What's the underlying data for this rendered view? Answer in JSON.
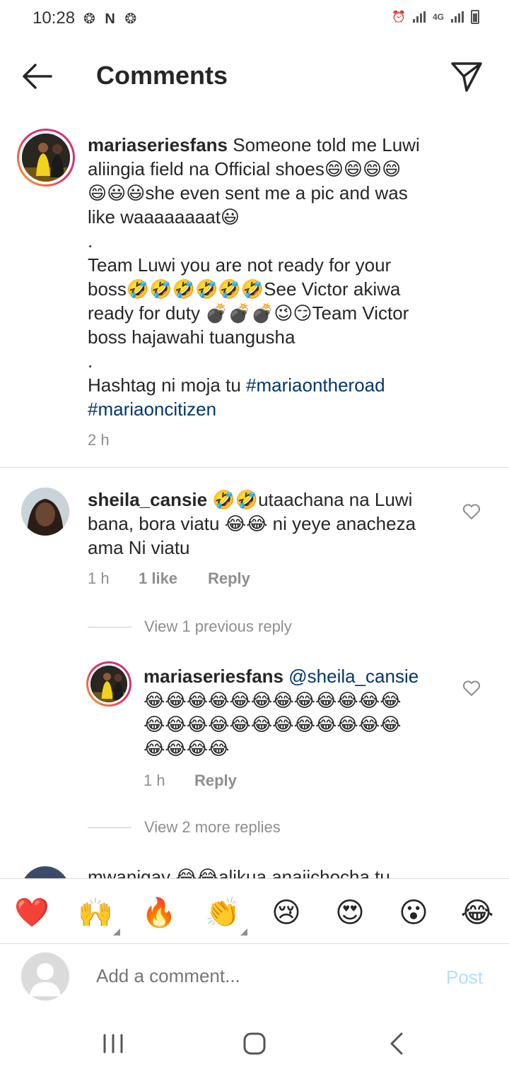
{
  "status": {
    "time": "10:28",
    "left_icons": "❂ N ❂",
    "network": "4G"
  },
  "header": {
    "title": "Comments"
  },
  "post": {
    "username": "mariaseriesfans",
    "line1": " Someone told me Luwi",
    "line2": "aliingia field na Official shoes😄😄😄😄",
    "line3": "😄😃😃she even sent me a pic and was",
    "line4": "like waaaaaaaat😃",
    "dot1": ".",
    "line5": "Team Luwi you are not ready for your",
    "line6": "boss🤣🤣🤣🤣🤣🤣See Victor akiwa",
    "line7": "ready for duty 💣💣💣😉😏Team Victor",
    "line8": "boss hajawahi tuangusha",
    "dot2": ".",
    "line9": "Hashtag ni moja tu ",
    "hashtag1": "#mariaontheroad",
    "hashtag2": "#mariaoncitizen",
    "time": "2 h"
  },
  "comments": [
    {
      "username": "sheila_cansie",
      "line1": " 🤣🤣utaachana na Luwi",
      "line2": "bana, bora viatu 😂😂 ni yeye anacheza",
      "line3": "ama Ni viatu",
      "time": "1 h",
      "likes": "1 like",
      "reply": "Reply",
      "view_replies": "View 1 previous reply"
    }
  ],
  "reply": {
    "username": "mariaseriesfans",
    "mention": " @sheila_cansie",
    "line2": "😂😂😂😂😂😂😂😂😂😂😂😂",
    "line3": "😂😂😂😂😂😂😂😂😂😂😂😂",
    "line4": "😂😂😂😂",
    "time": "1 h",
    "reply": "Reply",
    "view_more": "View 2 more replies"
  },
  "partial_comment": {
    "text": "mwanigay 😂😂alikua anajichocha tu"
  },
  "emoji_bar": [
    "❤️",
    "🙌",
    "🔥",
    "👏",
    "😢",
    "😍",
    "😮",
    "😂"
  ],
  "input": {
    "placeholder": "Add a comment...",
    "post_label": "Post"
  },
  "colors": {
    "link": "#00376b",
    "muted": "#8e8e8e",
    "post_disabled": "#b2dffc",
    "heart": "#ed4956"
  }
}
